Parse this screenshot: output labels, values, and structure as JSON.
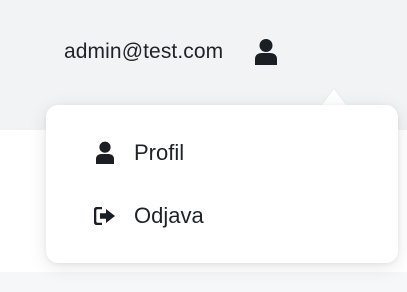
{
  "header": {
    "user_email": "admin@test.com",
    "user_icon": "user-icon"
  },
  "user_menu": {
    "items": [
      {
        "label": "Profil",
        "icon": "user-icon"
      },
      {
        "label": "Odjava",
        "icon": "sign-out-icon"
      }
    ]
  },
  "colors": {
    "topbar_background": "#f2f3f4",
    "text": "#1f2328",
    "icon": "#1b1f23",
    "menu_background": "#ffffff"
  }
}
